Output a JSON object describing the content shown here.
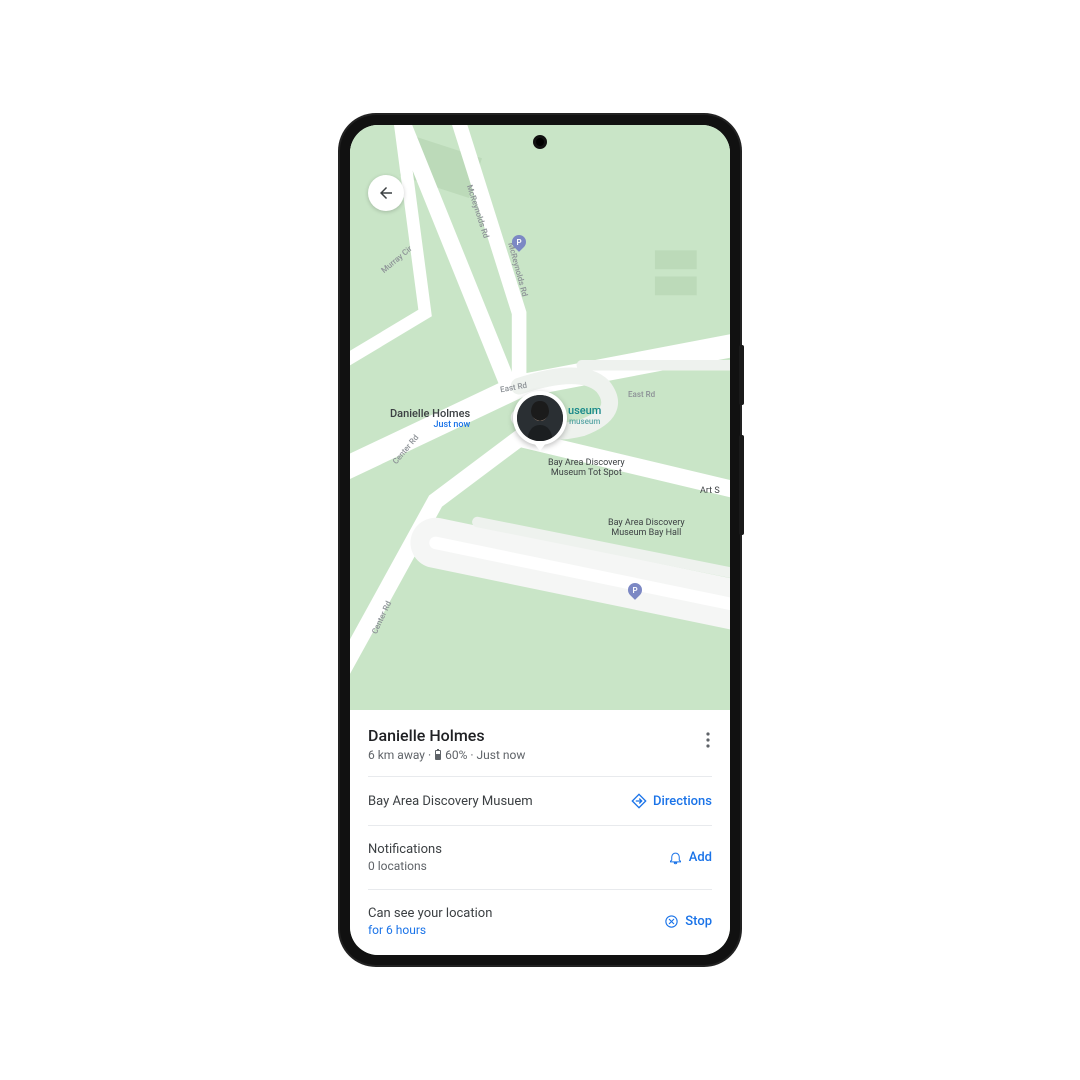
{
  "map": {
    "pin_name": "Danielle Holmes",
    "pin_time": "Just now",
    "place_main": "useum",
    "place_sub": "museum",
    "roads": {
      "mcreynolds_1": "McReynolds Rd",
      "mcreynolds_2": "McReynolds Rd",
      "murray": "Murray Cir",
      "center": "Center Rd",
      "east": "East Rd",
      "east_short": "East Rd",
      "center2": "Center Rd"
    },
    "poi": {
      "tot": "Bay Area Discovery\nMuseum Tot Spot",
      "hall": "Bay Area Discovery\nMuseum Bay Hall",
      "art": "Art S"
    },
    "parking": "P"
  },
  "sheet": {
    "name": "Danielle Holmes",
    "distance": "6 km away",
    "battery": "60%",
    "updated": "Just now",
    "place": "Bay Area Discovery Musuem",
    "directions_label": "Directions",
    "notif_title": "Notifications",
    "notif_sub": "0 locations",
    "notif_action": "Add",
    "share_title": "Can see your location",
    "share_sub": "for 6 hours",
    "share_action": "Stop"
  }
}
